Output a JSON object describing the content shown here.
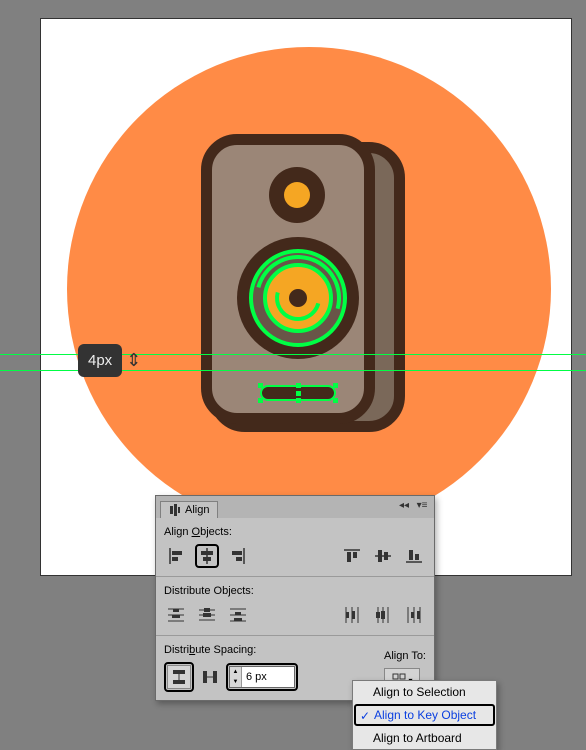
{
  "measurement": {
    "value": "4px"
  },
  "panel": {
    "title": "Align",
    "sections": {
      "align_objects_label_pre": "Align ",
      "align_objects_label_ul": "O",
      "align_objects_label_post": "bjects:",
      "distribute_objects_label": "Distribute Objects:",
      "distribute_spacing_label_pre": "Distri",
      "distribute_spacing_label_ul": "b",
      "distribute_spacing_label_post": "ute Spacing:",
      "align_to_label": "Align To:"
    },
    "spacing_value": "6 px"
  },
  "dropdown": {
    "items": [
      {
        "label": "Align to Selection",
        "selected": false
      },
      {
        "label": "Align to Key Object",
        "selected": true
      },
      {
        "label": "Align to Artboard",
        "selected": false
      }
    ]
  },
  "icons": {
    "align_h": [
      "align-left",
      "align-hcenter",
      "align-right"
    ],
    "align_v": [
      "align-top",
      "align-vcenter",
      "align-bottom"
    ],
    "dist_h": [
      "dist-top",
      "dist-vcenter",
      "dist-bottom"
    ],
    "dist_v": [
      "dist-left",
      "dist-hcenter",
      "dist-right"
    ],
    "spacing": [
      "dist-space-v",
      "dist-space-h"
    ]
  }
}
